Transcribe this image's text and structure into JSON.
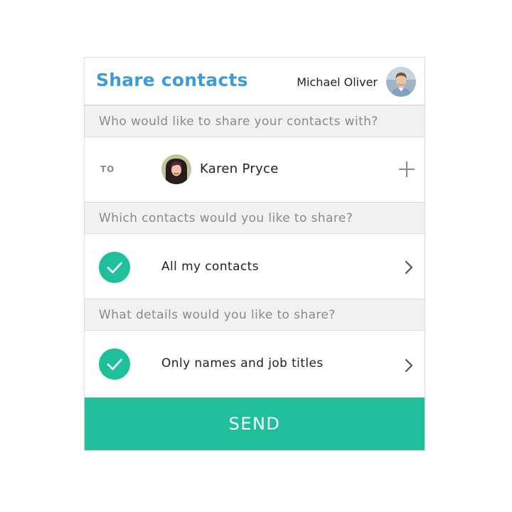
{
  "header": {
    "title": "Share contacts",
    "user_name": "Michael Oliver"
  },
  "recipient_section": {
    "prompt": "Who would like to share your contacts with?",
    "to_label": "TO",
    "recipient_name": "Karen Pryce",
    "add_icon": "plus-icon"
  },
  "contacts_section": {
    "prompt": "Which contacts would you like to share?",
    "selected_option": "All my contacts"
  },
  "details_section": {
    "prompt": "What details would you like to share?",
    "selected_option": "Only names and job titles"
  },
  "send_label": "SEND",
  "colors": {
    "accent_blue": "#3d9bd6",
    "accent_green": "#1ebf9a",
    "section_bg": "#f1f1f1",
    "border": "#dcdcdc"
  }
}
